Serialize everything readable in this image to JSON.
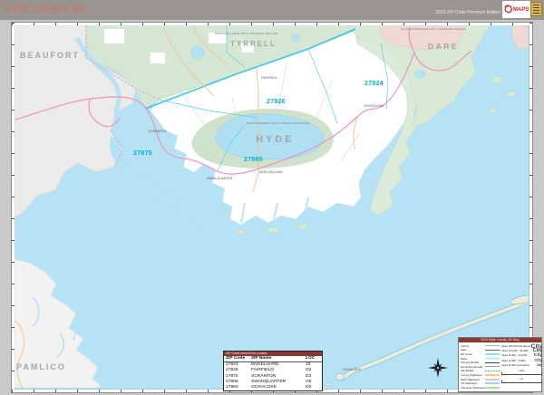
{
  "header": {
    "title": "HYDE COUNTY, NC",
    "edition": "2020 ZIP Code Premium Edition",
    "logo_text": "MAPS"
  },
  "map": {
    "county_labels": {
      "beaufort": "BEAUFORT",
      "tyrrell": "TYRRELL",
      "dare": "DARE",
      "hyde": "HYDE",
      "pamlico": "PAMLICO"
    },
    "zip_labels": {
      "z27824": "27824",
      "z27826": "27826",
      "z27875": "27875",
      "z27885": "27885"
    },
    "refuges": {
      "mattamuskeet": "MATTAMUSKEET NAT'L WILDLIFE REFUGE",
      "pocosin": "POCOSIN LAKES NAT'L WILDLIFE REFUGE",
      "alligator": "ALLIGATOR RIVER NAT'L WILDLIFE REFUGE"
    },
    "towns": {
      "engelhard": "ENGELHARD",
      "fairfield": "FAIRFIELD",
      "swanquarter": "SWAN QUARTER",
      "scranton": "SCRANTON",
      "new_holland": "NEW HOLLAND",
      "ocracoke": "OCRACOKE"
    }
  },
  "zip_table": {
    "title": "ZIP Code Index/Grid Locator",
    "columns": [
      "ZIP Code",
      "ZIP Name",
      "LOC"
    ],
    "rows": [
      {
        "zip": "27824",
        "name": "ENGELHARD",
        "loc": "J3"
      },
      {
        "zip": "27826",
        "name": "FAIRFIELD",
        "loc": "G2"
      },
      {
        "zip": "27875",
        "name": "SCRANTON",
        "loc": "D3"
      },
      {
        "zip": "27885",
        "name": "SWANQUARTER",
        "loc": "G5"
      },
      {
        "zip": "27960",
        "name": "OCRACOKE",
        "loc": "K9"
      }
    ]
  },
  "legend": {
    "title": "2020 Hyde County, NC Map",
    "items": [
      {
        "label": "County"
      },
      {
        "label": "State"
      },
      {
        "label": "ZIP Code"
      },
      {
        "label": "Water"
      },
      {
        "label": "Primary Roads"
      },
      {
        "label": "Secondary Roads"
      },
      {
        "label": "Rail Roads"
      },
      {
        "label": "County Highways"
      },
      {
        "label": "State Highways"
      },
      {
        "label": "US Highways"
      },
      {
        "label": "Interstate Highways"
      }
    ],
    "city_classes": [
      {
        "label": "Cities (25,000 and above)",
        "sample": "City"
      },
      {
        "label": "Cities (10,000 - 25,000)",
        "sample": "City"
      },
      {
        "label": "Cities (5,000 - 10,000)",
        "sample": "City"
      },
      {
        "label": "Cities (2,500 - 5,000)",
        "sample": "City"
      },
      {
        "label": "Cities (2,500 and below)",
        "sample": "City"
      }
    ],
    "scale": {
      "miles": "miles",
      "km": "km"
    }
  },
  "colors": {
    "header_bar": "#9b938f",
    "header_title": "#c8756a",
    "water": "#b5e2f4",
    "land_white": "#ffffff",
    "land_gray": "#ebebe9",
    "refuge_green": "#d5e7d4",
    "dare_salmon": "#f0d9d3",
    "zip_label": "#00b0d8",
    "us_highway_pink": "#ef93bb",
    "county_highway_tan": "#f2c68c",
    "boundary_cyan": "#55cfe9",
    "panel_title_red": "#8c3832"
  }
}
